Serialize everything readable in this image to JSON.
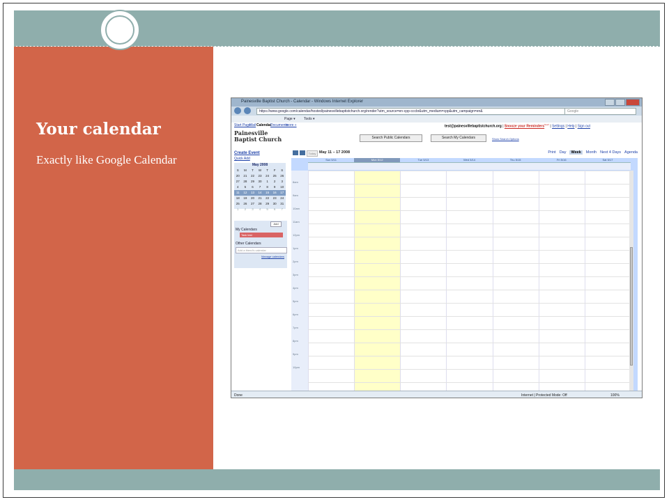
{
  "slide": {
    "title": "Your calendar",
    "subtitle": "Exactly like Google Calendar"
  },
  "browser": {
    "window_title": "Painesville Baptist Church - Calendar - Windows Internet Explorer",
    "url": "https://www.google.com/calendar/hosted/painesvillebaptistchurch.org/render?utm_source=en-cpp-cccbr&utm_medium=cpp&utm_campaign=en&",
    "search_placeholder": "Google",
    "menu": {
      "page": "Page ▾",
      "tools": "Tools ▾"
    },
    "status": "Done",
    "zone": "Internet | Protected Mode: Off",
    "zoom": "100%"
  },
  "calendar": {
    "top_links": [
      "Start Page",
      "Mail",
      "Calendar",
      "Documents",
      "more »"
    ],
    "user_email": "test@painesvillebaptistchurch.org",
    "snooze": "Snooze your Reminders",
    "snooze_sup": "New!",
    "settings": "Settings",
    "help": "Help",
    "sign_out": "Sign out",
    "logo_line1": "Painesville",
    "logo_line2": "Baptist Church",
    "search_public": "Search Public Calendars",
    "search_mine": "Search My Calendars",
    "show_search_options": "Show Search Options",
    "create_event": "Create Event",
    "quick_add": "Quick Add",
    "today_button": "Today",
    "date_range": "May 11 – 17 2008",
    "print": "Print",
    "views": [
      "Day",
      "Week",
      "Month",
      "Next 4 Days",
      "Agenda"
    ],
    "active_view": "Week",
    "day_headers": [
      "Sun 5/11",
      "Mon 5/12",
      "Tue 5/13",
      "Wed 5/14",
      "Thu 5/15",
      "Fri 5/16",
      "Sat 5/17"
    ],
    "times": [
      "8am",
      "9am",
      "10am",
      "11am",
      "12pm",
      "1pm",
      "2pm",
      "3pm",
      "4pm",
      "5pm",
      "6pm",
      "7pm",
      "8pm",
      "9pm",
      "10pm"
    ],
    "minical": {
      "month": "May 2008",
      "weekdays": [
        "S",
        "M",
        "T",
        "W",
        "T",
        "F",
        "S"
      ],
      "weeks": [
        [
          "20",
          "21",
          "22",
          "23",
          "24",
          "25",
          "26"
        ],
        [
          "27",
          "28",
          "29",
          "30",
          "1",
          "2",
          "3"
        ],
        [
          "4",
          "5",
          "6",
          "7",
          "8",
          "9",
          "10"
        ],
        [
          "11",
          "12",
          "13",
          "14",
          "15",
          "16",
          "17"
        ],
        [
          "18",
          "19",
          "20",
          "21",
          "22",
          "23",
          "24"
        ],
        [
          "25",
          "26",
          "27",
          "28",
          "29",
          "30",
          "31"
        ],
        [
          "1",
          "2",
          "3",
          "4",
          "5",
          "6",
          "7"
        ]
      ]
    },
    "add_button": "Add",
    "my_calendars": "My Calendars",
    "my_calendar_item": "Task test",
    "other_calendars": "Other Calendars",
    "add_friend_placeholder": "Add a friend's calendar",
    "manage_calendars": "Manage calendars"
  }
}
